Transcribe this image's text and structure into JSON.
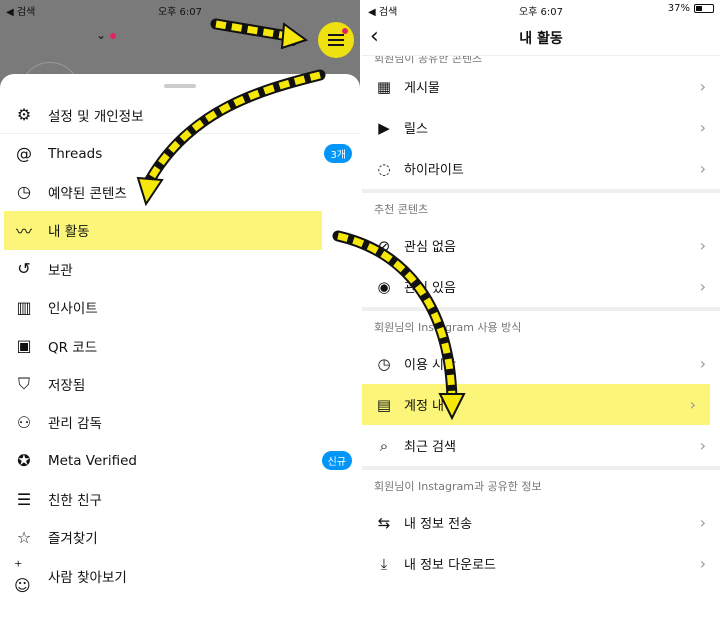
{
  "status": {
    "back_label": "◀ 검색",
    "time": "오후 6:07",
    "battery": "37%"
  },
  "left": {
    "menu": [
      {
        "icon": "settings-icon",
        "label": "설정 및 개인정보",
        "badge": ""
      },
      {
        "icon": "threads-icon",
        "label": "Threads",
        "badge": "3개"
      },
      {
        "icon": "clock-icon",
        "label": "예약된 콘텐츠",
        "badge": ""
      },
      {
        "icon": "activity-icon",
        "label": "내 활동",
        "badge": ""
      },
      {
        "icon": "archive-icon",
        "label": "보관",
        "badge": ""
      },
      {
        "icon": "insights-icon",
        "label": "인사이트",
        "badge": ""
      },
      {
        "icon": "qr-icon",
        "label": "QR 코드",
        "badge": ""
      },
      {
        "icon": "bookmark-icon",
        "label": "저장됨",
        "badge": ""
      },
      {
        "icon": "supervision-icon",
        "label": "관리 감독",
        "badge": ""
      },
      {
        "icon": "verified-icon",
        "label": "Meta Verified",
        "badge": "신규"
      },
      {
        "icon": "close-friends-icon",
        "label": "친한 친구",
        "badge": ""
      },
      {
        "icon": "star-icon",
        "label": "즐겨찾기",
        "badge": ""
      },
      {
        "icon": "discover-people-icon",
        "label": "사람 찾아보기",
        "badge": ""
      }
    ],
    "highlighted_index": 3
  },
  "right": {
    "title": "내 활동",
    "sections": [
      {
        "heading": "회원님이 공유한 콘텐츠",
        "items": [
          {
            "icon": "grid-icon",
            "label": "게시물"
          },
          {
            "icon": "reels-icon",
            "label": "릴스"
          },
          {
            "icon": "highlights-icon",
            "label": "하이라이트"
          }
        ]
      },
      {
        "heading": "추천 콘텐츠",
        "items": [
          {
            "icon": "eye-off-icon",
            "label": "관심 없음"
          },
          {
            "icon": "eye-icon",
            "label": "관심 있음"
          }
        ]
      },
      {
        "heading": "회원님의 Instagram 사용 방식",
        "items": [
          {
            "icon": "clock-icon",
            "label": "이용 시간"
          },
          {
            "icon": "calendar-icon",
            "label": "계정 내역"
          },
          {
            "icon": "search-icon",
            "label": "최근 검색"
          }
        ]
      },
      {
        "heading": "회원님이 Instagram과 공유한 정보",
        "items": [
          {
            "icon": "transfer-icon",
            "label": "내 정보 전송"
          },
          {
            "icon": "download-icon",
            "label": "내 정보 다운로드"
          }
        ]
      }
    ],
    "highlighted_label": "계정 내역"
  },
  "colors": {
    "highlight": "#fbf67a",
    "arrow": "#f5e70a",
    "badge_blue": "#0095f6"
  }
}
